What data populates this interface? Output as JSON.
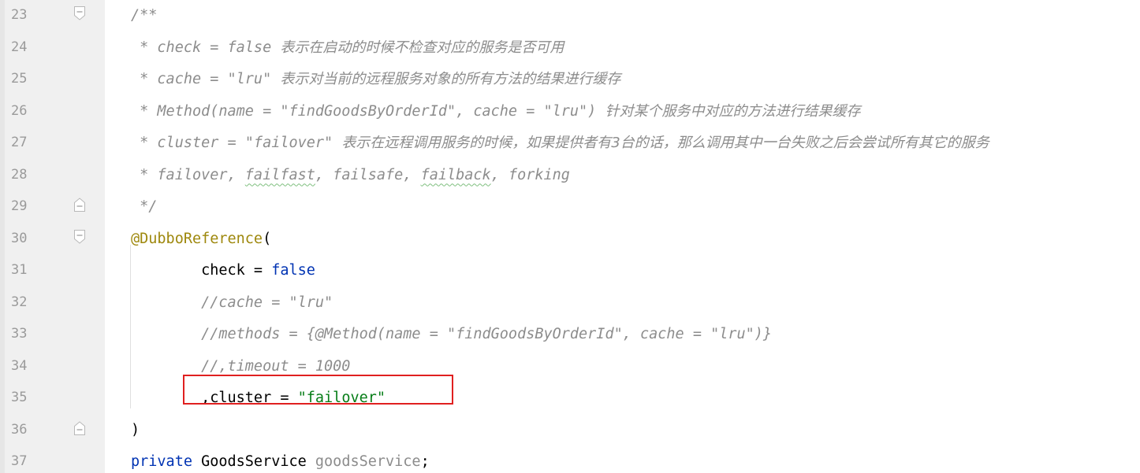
{
  "editor": {
    "lines": [
      {
        "num": "23",
        "fold": "fold-start",
        "segments": [
          {
            "cls": "c-comment",
            "text": "/**"
          }
        ]
      },
      {
        "num": "24",
        "fold": "",
        "segments": [
          {
            "cls": "c-comment",
            "text": " * check = false "
          },
          {
            "cls": "c-comment c-cjk",
            "text": "表示在启动的时候不检查对应的服务是否可用"
          }
        ]
      },
      {
        "num": "25",
        "fold": "",
        "segments": [
          {
            "cls": "c-comment",
            "text": " * cache = \"lru\" "
          },
          {
            "cls": "c-comment c-cjk",
            "text": "表示对当前的远程服务对象的所有方法的结果进行缓存"
          }
        ]
      },
      {
        "num": "26",
        "fold": "",
        "segments": [
          {
            "cls": "c-comment",
            "text": " * Method(name = \"findGoodsByOrderId\", cache = \"lru\") "
          },
          {
            "cls": "c-comment c-cjk",
            "text": "针对某个服务中对应的方法进行结果缓存"
          }
        ]
      },
      {
        "num": "27",
        "fold": "",
        "segments": [
          {
            "cls": "c-comment",
            "text": " * cluster = \"failover\" "
          },
          {
            "cls": "c-comment c-cjk",
            "text": "表示在远程调用服务的时候，如果提供者有3台的话，那么调用其中一台失败之后会尝试所有其它的服务"
          }
        ]
      },
      {
        "num": "28",
        "fold": "",
        "segments": [
          {
            "cls": "c-comment",
            "text": " * failover, "
          },
          {
            "cls": "c-comment squiggle",
            "text": "failfast"
          },
          {
            "cls": "c-comment",
            "text": ", failsafe, "
          },
          {
            "cls": "c-comment squiggle",
            "text": "failback"
          },
          {
            "cls": "c-comment",
            "text": ", forking"
          }
        ]
      },
      {
        "num": "29",
        "fold": "fold-end",
        "segments": [
          {
            "cls": "c-comment",
            "text": " */"
          }
        ]
      },
      {
        "num": "30",
        "fold": "fold-start",
        "segments": [
          {
            "cls": "c-annot",
            "text": "@DubboReference"
          },
          {
            "cls": "c-plain",
            "text": "("
          }
        ]
      },
      {
        "num": "31",
        "fold": "",
        "segments": [
          {
            "cls": "c-plain",
            "text": "        check = "
          },
          {
            "cls": "c-kw",
            "text": "false"
          }
        ]
      },
      {
        "num": "32",
        "fold": "",
        "segments": [
          {
            "cls": "c-comment",
            "text": "        //cache = \"lru\""
          }
        ]
      },
      {
        "num": "33",
        "fold": "",
        "segments": [
          {
            "cls": "c-comment",
            "text": "        //methods = {@Method(name = \"findGoodsByOrderId\", cache = \"lru\")}"
          }
        ]
      },
      {
        "num": "34",
        "fold": "",
        "segments": [
          {
            "cls": "c-comment",
            "text": "        //,timeout = 1000"
          }
        ]
      },
      {
        "num": "35",
        "fold": "",
        "segments": [
          {
            "cls": "c-plain",
            "text": "        ,cluster = "
          },
          {
            "cls": "c-str",
            "text": "\"failover\""
          }
        ]
      },
      {
        "num": "36",
        "fold": "fold-end",
        "segments": [
          {
            "cls": "c-plain",
            "text": ")"
          }
        ]
      },
      {
        "num": "37",
        "fold": "",
        "segments": [
          {
            "cls": "c-kw",
            "text": "private "
          },
          {
            "cls": "c-plain",
            "text": "GoodsService "
          },
          {
            "cls": "c-unused",
            "text": "goodsService"
          },
          {
            "cls": "c-plain",
            "text": ";"
          }
        ]
      }
    ]
  },
  "highlight": {
    "line": "35",
    "color": "#e02020"
  },
  "colors": {
    "comment": "#8c8c8c",
    "annotation": "#9e880d",
    "keyword": "#0033b3",
    "string": "#067d17",
    "gutter_bg": "#f0f0f0",
    "line_number": "#9a9a9a"
  },
  "icons": {
    "fold-start": "fold-open-icon",
    "fold-end": "fold-end-icon"
  }
}
